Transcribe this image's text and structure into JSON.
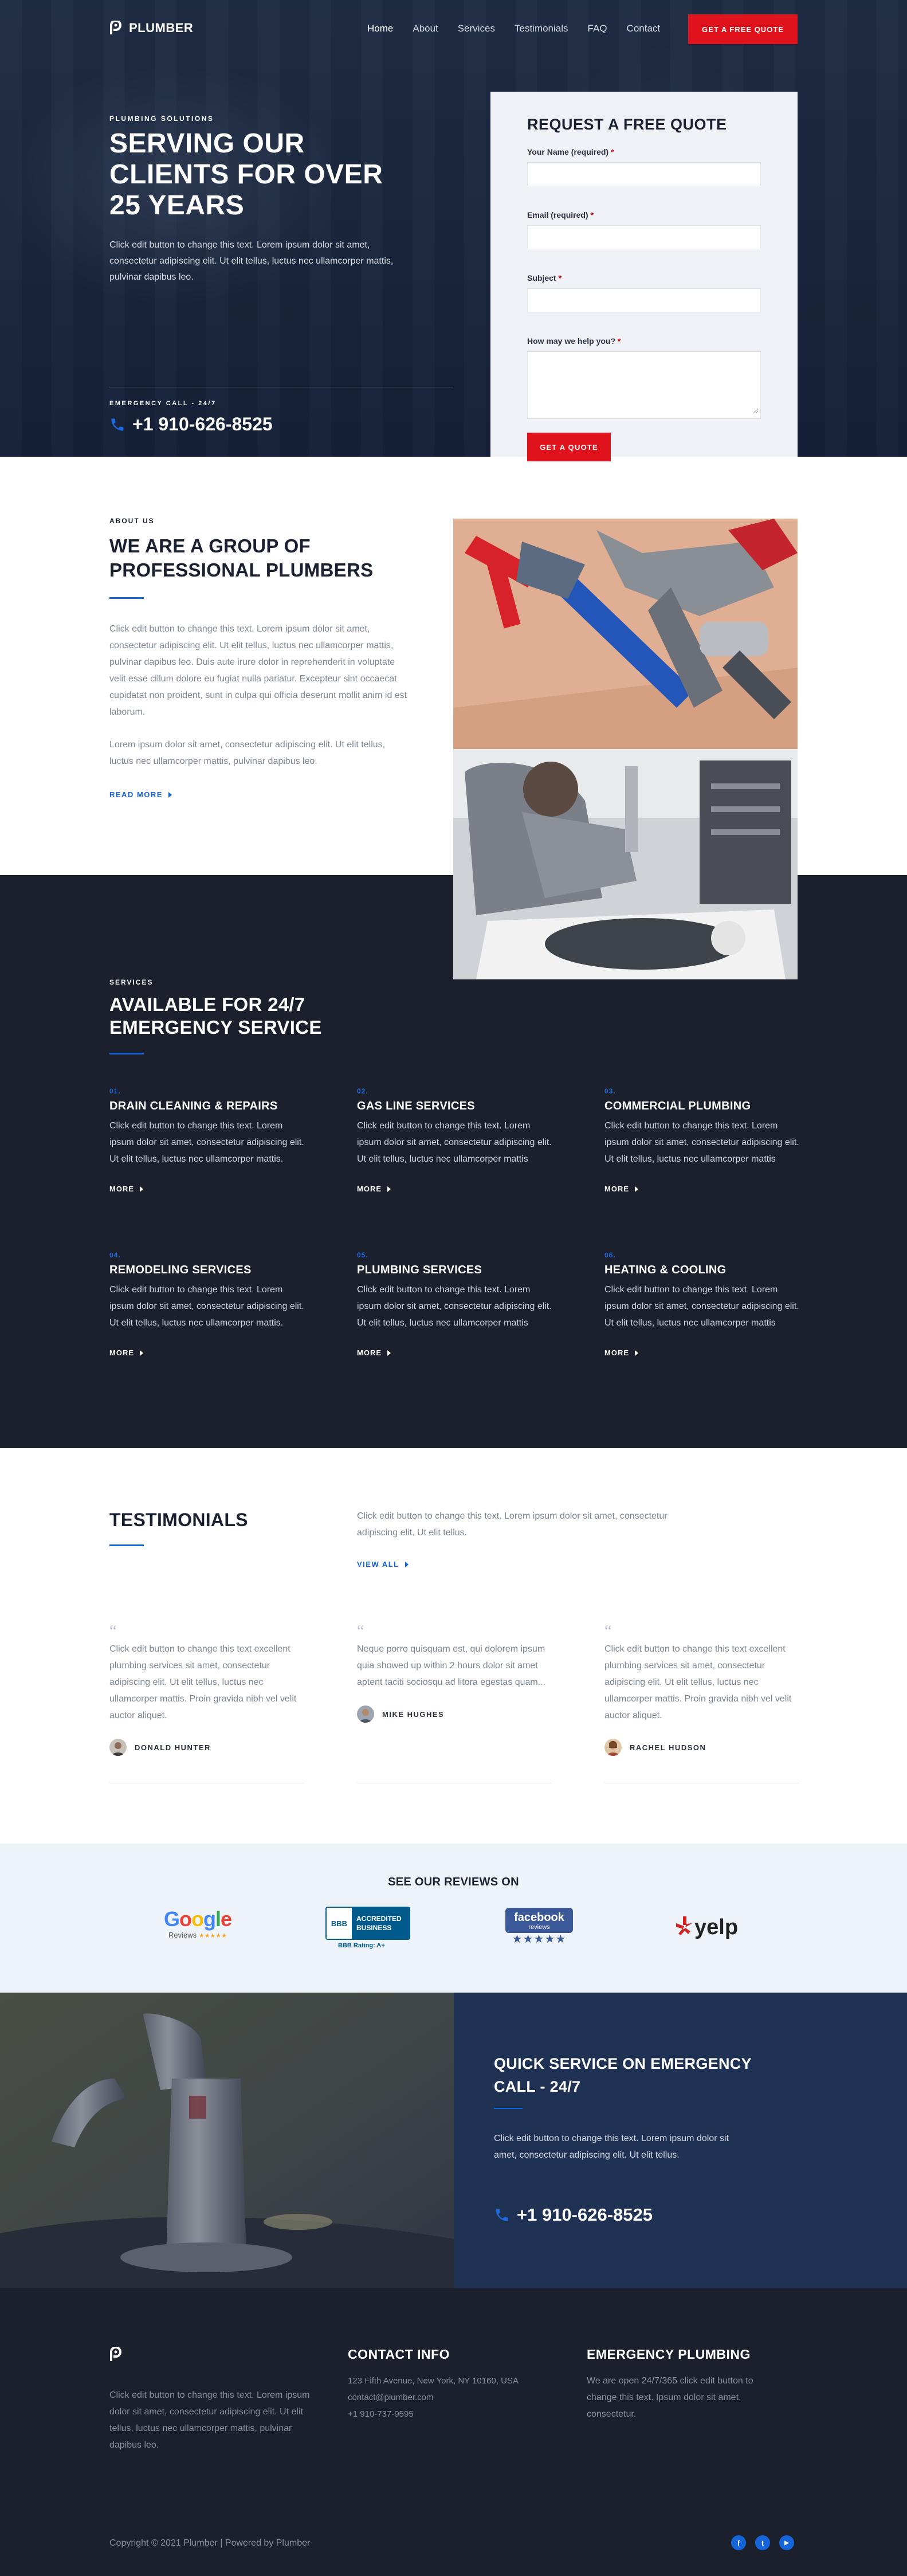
{
  "nav": {
    "logo": "PLUMBER",
    "items": [
      "Home",
      "About",
      "Services",
      "Testimonials",
      "FAQ",
      "Contact"
    ],
    "cta": "GET A FREE QUOTE"
  },
  "hero": {
    "eyebrow": "PLUMBING SOLUTIONS",
    "title_lines": [
      "SERVING OUR",
      "CLIENTS FOR OVER",
      "25 YEARS"
    ],
    "description": "Click edit button to change this text. Lorem ipsum dolor sit amet, consectetur adipiscing elit. Ut elit tellus, luctus nec ullamcorper mattis, pulvinar dapibus leo.",
    "emergency_label": "EMERGENCY CALL - 24/7",
    "phone": "+1 910-626-8525"
  },
  "quote_form": {
    "title": "REQUEST A FREE QUOTE",
    "fields": [
      {
        "label": "Your Name (required)",
        "required": "*",
        "value": ""
      },
      {
        "label": "Email (required)",
        "required": "*",
        "value": ""
      },
      {
        "label": "Subject",
        "required": "*",
        "value": ""
      },
      {
        "label": "How may we help you?",
        "required": "*",
        "value": ""
      }
    ],
    "submit": "GET A QUOTE"
  },
  "about": {
    "eyebrow": "ABOUT US",
    "title_lines": [
      "WE ARE A GROUP OF",
      "PROFESSIONAL PLUMBERS"
    ],
    "p1": "Click edit button to change this text. Lorem ipsum dolor sit amet, consectetur adipiscing elit. Ut elit tellus, luctus nec ullamcorper mattis, pulvinar dapibus leo. Duis aute irure dolor in reprehenderit in voluptate velit esse cillum dolore eu fugiat nulla pariatur. Excepteur sint occaecat cupidatat non proident, sunt in culpa qui officia deserunt mollit anim id est laborum.",
    "p2": "Lorem ipsum dolor sit amet, consectetur adipiscing elit. Ut elit tellus, luctus nec ullamcorper mattis, pulvinar dapibus leo.",
    "read_more": "READ MORE"
  },
  "services": {
    "eyebrow": "SERVICES",
    "title_lines": [
      "AVAILABLE FOR 24/7",
      "EMERGENCY SERVICE"
    ],
    "more_label": "MORE",
    "items": [
      {
        "num": "01.",
        "title": "DRAIN CLEANING & REPAIRS",
        "desc": "Click edit button to change this text. Lorem ipsum dolor sit amet, consectetur adipiscing elit. Ut elit tellus, luctus nec ullamcorper mattis."
      },
      {
        "num": "02.",
        "title": "GAS LINE SERVICES",
        "desc": "Click edit button to change this text. Lorem ipsum dolor sit amet, consectetur adipiscing elit. Ut elit tellus, luctus nec ullamcorper mattis"
      },
      {
        "num": "03.",
        "title": "COMMERCIAL PLUMBING",
        "desc": "Click edit button to change this text. Lorem ipsum dolor sit amet, consectetur adipiscing elit. Ut elit tellus, luctus nec ullamcorper mattis"
      },
      {
        "num": "04.",
        "title": "REMODELING SERVICES",
        "desc": "Click edit button to change this text. Lorem ipsum dolor sit amet, consectetur adipiscing elit. Ut elit tellus, luctus nec ullamcorper mattis."
      },
      {
        "num": "05.",
        "title": "PLUMBING SERVICES",
        "desc": "Click edit button to change this text. Lorem ipsum dolor sit amet, consectetur adipiscing elit. Ut elit tellus, luctus nec ullamcorper mattis"
      },
      {
        "num": "06.",
        "title": "HEATING & COOLING",
        "desc": "Click edit button to change this text. Lorem ipsum dolor sit amet, consectetur adipiscing elit. Ut elit tellus, luctus nec ullamcorper mattis"
      }
    ]
  },
  "testimonials": {
    "title": "TESTIMONIALS",
    "intro": "Click edit button to change this text. Lorem ipsum dolor sit amet, consectetur adipiscing elit. Ut elit tellus.",
    "view_all": "VIEW ALL",
    "quote_mark": "“",
    "items": [
      {
        "text": "Click edit button to change this text excellent plumbing services sit amet, consectetur adipiscing elit. Ut elit tellus, luctus nec ullamcorper mattis. Proin gravida nibh vel velit auctor aliquet.",
        "author": "DONALD HUNTER"
      },
      {
        "text": "Neque porro quisquam est, qui dolorem ipsum quia showed up within 2 hours dolor sit amet aptent taciti sociosqu ad litora egestas quam...",
        "author": "MIKE HUGHES"
      },
      {
        "text": "Click edit button to change this text excellent plumbing services sit amet, consectetur adipiscing elit. Ut elit tellus, luctus nec ullamcorper mattis. Proin gravida nibh vel velit auctor aliquet.",
        "author": "RACHEL HUDSON"
      }
    ]
  },
  "reviews": {
    "title": "SEE OUR REVIEWS ON",
    "google": {
      "word": "Google",
      "sub": "Reviews",
      "stars": "★★★★★"
    },
    "bbb": {
      "mark": "BBB",
      "line1": "ACCREDITED",
      "line2": "BUSINESS",
      "rating": "BBB Rating: A+"
    },
    "facebook": {
      "word": "facebook",
      "sub": "reviews",
      "stars": "★★★★★"
    },
    "yelp": {
      "word": "yelp"
    }
  },
  "quick": {
    "title_lines": [
      "QUICK SERVICE ON EMERGENCY",
      "CALL - 24/7"
    ],
    "desc": "Click edit button to change this text. Lorem ipsum dolor sit amet, consectetur adipiscing elit. Ut elit tellus.",
    "phone": "+1 910-626-8525"
  },
  "footer": {
    "about": "Click edit button to change this text. Lorem ipsum dolor sit amet, consectetur adipiscing elit. Ut elit tellus, luctus nec ullamcorper mattis, pulvinar dapibus leo.",
    "contact_title": "CONTACT INFO",
    "address": "123 Fifth Avenue, New York, NY 10160, USA",
    "email": "contact@plumber.com",
    "phone": "+1 910-737-9595",
    "emergency_title": "EMERGENCY PLUMBING",
    "emergency_text": "We are open 24/7/365 click edit button to change this text. Ipsum dolor sit amet, consectetur.",
    "copyright": "Copyright © 2021 Plumber | Powered by Plumber",
    "social": [
      "f",
      "t",
      "▶"
    ]
  },
  "colors": {
    "accent": "#1565d8",
    "cta": "#e0121b",
    "dark": "#1b202c",
    "navy": "#203253"
  }
}
